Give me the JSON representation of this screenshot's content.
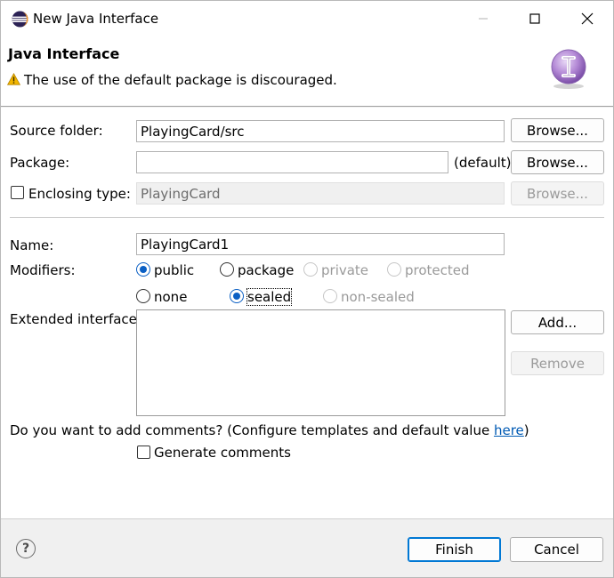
{
  "window": {
    "title": "New Java Interface",
    "minimize_glyph": "─",
    "maximize_glyph": "☐",
    "close_glyph": "✕"
  },
  "header": {
    "title": "Java Interface",
    "warning": "The use of the default package is discouraged."
  },
  "form": {
    "source_folder": {
      "label": "Source folder:",
      "value": "PlayingCard/src",
      "browse": "Browse..."
    },
    "package": {
      "label": "Package:",
      "value": "",
      "suffix": "(default)",
      "browse": "Browse..."
    },
    "enclosing_type": {
      "label": "Enclosing type:",
      "value": "PlayingCard",
      "browse": "Browse...",
      "checked": false
    },
    "name": {
      "label": "Name:",
      "value": "PlayingCard1"
    },
    "modifiers": {
      "label": "Modifiers:",
      "row1": [
        {
          "label": "public",
          "checked": true,
          "enabled": true
        },
        {
          "label": "package",
          "checked": false,
          "enabled": true
        },
        {
          "label": "private",
          "checked": false,
          "enabled": false
        },
        {
          "label": "protected",
          "checked": false,
          "enabled": false
        }
      ],
      "row2": [
        {
          "label": "none",
          "checked": false,
          "enabled": true
        },
        {
          "label": "sealed",
          "checked": true,
          "enabled": true
        },
        {
          "label": "non-sealed",
          "checked": false,
          "enabled": false
        }
      ]
    },
    "extended_interfaces": {
      "label": "Extended interfaces:",
      "add": "Add...",
      "remove": "Remove",
      "items": []
    },
    "comments": {
      "question_prefix": "Do you want to add comments? (Configure templates and default value ",
      "link": "here",
      "question_suffix": ")",
      "generate_label": "Generate comments",
      "generate_checked": false
    }
  },
  "footer": {
    "help": "?",
    "finish": "Finish",
    "cancel": "Cancel"
  },
  "colors": {
    "accent": "#0078d4",
    "link": "#005ab4",
    "warning": "#f2b600"
  }
}
